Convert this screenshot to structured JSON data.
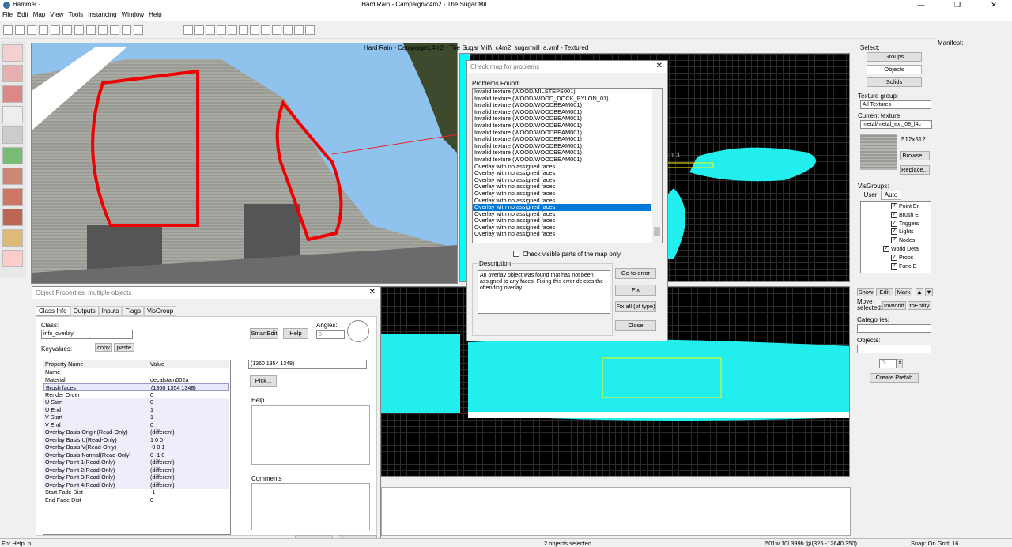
{
  "app": {
    "title": "Hammer -",
    "document_title": ".Hard Rain - Campaign\\c4m2 - The Sugar Mil"
  },
  "window_controls": {
    "min": "—",
    "max": "❐",
    "close": "✕"
  },
  "menu": [
    "File",
    "Edit",
    "Map",
    "View",
    "Tools",
    "Instancing",
    "Window",
    "Help"
  ],
  "viewport3d": {
    "title": "Hard Rain - Campaign\\c4m2 - The Sugar Mill\\_c4m2_sugarmill_a.vmf - Textured"
  },
  "grid_label": "01.3",
  "problems_dialog": {
    "title": "Check map for problems",
    "found_label": "Problems Found:",
    "problems": [
      "Invalid texture (WOOD/MILSTEPS001)",
      "Invalid texture (WOOD/WOOD_DOCK_PYLON_01)",
      "Invalid texture (WOOD/WOODBEAM001)",
      "Invalid texture (WOOD/WOODBEAM001)",
      "Invalid texture (WOOD/WOODBEAM001)",
      "Invalid texture (WOOD/WOODBEAM001)",
      "Invalid texture (WOOD/WOODBEAM001)",
      "Invalid texture (WOOD/WOODBEAM001)",
      "Invalid texture (WOOD/WOODBEAM001)",
      "Invalid texture (WOOD/WOODBEAM001)",
      "Invalid texture (WOOD/WOODBEAM001)",
      "Overlay with no assigned faces",
      "Overlay with no assigned faces",
      "Overlay with no assigned faces",
      "Overlay with no assigned faces",
      "Overlay with no assigned faces",
      "Overlay with no assigned faces",
      "Overlay with no assigned faces",
      "Overlay with no assigned faces",
      "Overlay with no assigned faces",
      "Overlay with no assigned faces",
      "Overlay with no assigned faces"
    ],
    "selected_index": 17,
    "check_visible_label": "Check visible parts of the map only",
    "description_label": "Description",
    "description": "An overlay object was found that has not been assigned to any faces.  Fixing this error deletes the offending overlay.",
    "go_to_error": "Go to error",
    "fix": "Fix",
    "fix_all": "Fix all (of type)",
    "close": "Close"
  },
  "object_properties": {
    "title": "Object Properties: multiple objects",
    "tabs": [
      "Class Info",
      "Outputs",
      "Inputs",
      "Flags",
      "VisGroup"
    ],
    "class_label": "Class:",
    "class_value": "info_overlay",
    "keyvalues_label": "Keyvalues:",
    "copy": "copy",
    "paste": "paste",
    "smartedit": "SmartEdit",
    "help": "Help",
    "angles_label": "Angles:",
    "angles_value": "0",
    "col_property": "Property Name",
    "col_value": "Value",
    "rows": [
      {
        "name": "Name",
        "value": ""
      },
      {
        "name": "Material",
        "value": "decalstain002a"
      },
      {
        "name": "Brush faces",
        "value": "(1360 1354 1348)"
      },
      {
        "name": "Render Order",
        "value": "0"
      },
      {
        "name": "U Start",
        "value": "0"
      },
      {
        "name": "U End",
        "value": "1"
      },
      {
        "name": "V Start",
        "value": "1"
      },
      {
        "name": "V End",
        "value": "0"
      },
      {
        "name": "Overlay Basis Origin(Read-Only)",
        "value": "(different)"
      },
      {
        "name": "Overlay Basis U(Read-Only)",
        "value": "1 0 0"
      },
      {
        "name": "Overlay Basis V(Read-Only)",
        "value": "-0 0 1"
      },
      {
        "name": "Overlay Basis Normal(Read-Only)",
        "value": "0 -1 0"
      },
      {
        "name": "Overlay Point 1(Read-Only)",
        "value": "(different)"
      },
      {
        "name": "Overlay Point 2(Read-Only)",
        "value": "(different)"
      },
      {
        "name": "Overlay Point 3(Read-Only)",
        "value": "(different)"
      },
      {
        "name": "Overlay Point 4(Read-Only)",
        "value": "(different)"
      },
      {
        "name": "Start Fade Dist",
        "value": "-1"
      },
      {
        "name": "End Fade Dist",
        "value": "0"
      }
    ],
    "value_field": "(1360 1354 1348)",
    "pick": "Pick...",
    "help_label": "Help",
    "comments_label": "Comments",
    "cancel": "Abbrechen",
    "apply": "Übernehmen"
  },
  "right_panel": {
    "select_label": "Select:",
    "groups": "Groups",
    "objects": "Objects",
    "solids": "Solids",
    "texture_group_label": "Texture group:",
    "texture_group_value": "All Textures",
    "current_texture_label": "Current texture:",
    "current_texture_value": "metal/metal_ext_08_l4c",
    "texture_size": "512x512",
    "browse": "Browse...",
    "replace": "Replace...",
    "visgroups_label": "VisGroups:",
    "tab_user": "User",
    "tab_auto": "Auto",
    "visgroups": [
      "Point En",
      "Brush E",
      "Triggers",
      "Lights",
      "Nodes",
      "World Deta",
      "Props",
      "Func D"
    ],
    "show": "Show",
    "edit": "Edit",
    "mark": "Mark",
    "move_selected": "Move selected:",
    "to_world": "toWorld",
    "to_entity": "toEntity",
    "categories_label": "Categories:",
    "objects_label": "Objects:",
    "count_value": "0",
    "create_prefab": "Create Prefab"
  },
  "manifest_label": "Manifest:",
  "status": {
    "help": "For Help, p",
    "selection": "2 objects selected.",
    "coords": "501w 10l 399h @(326 -12640 350)",
    "snap": "Snap: On Grid: 16"
  }
}
